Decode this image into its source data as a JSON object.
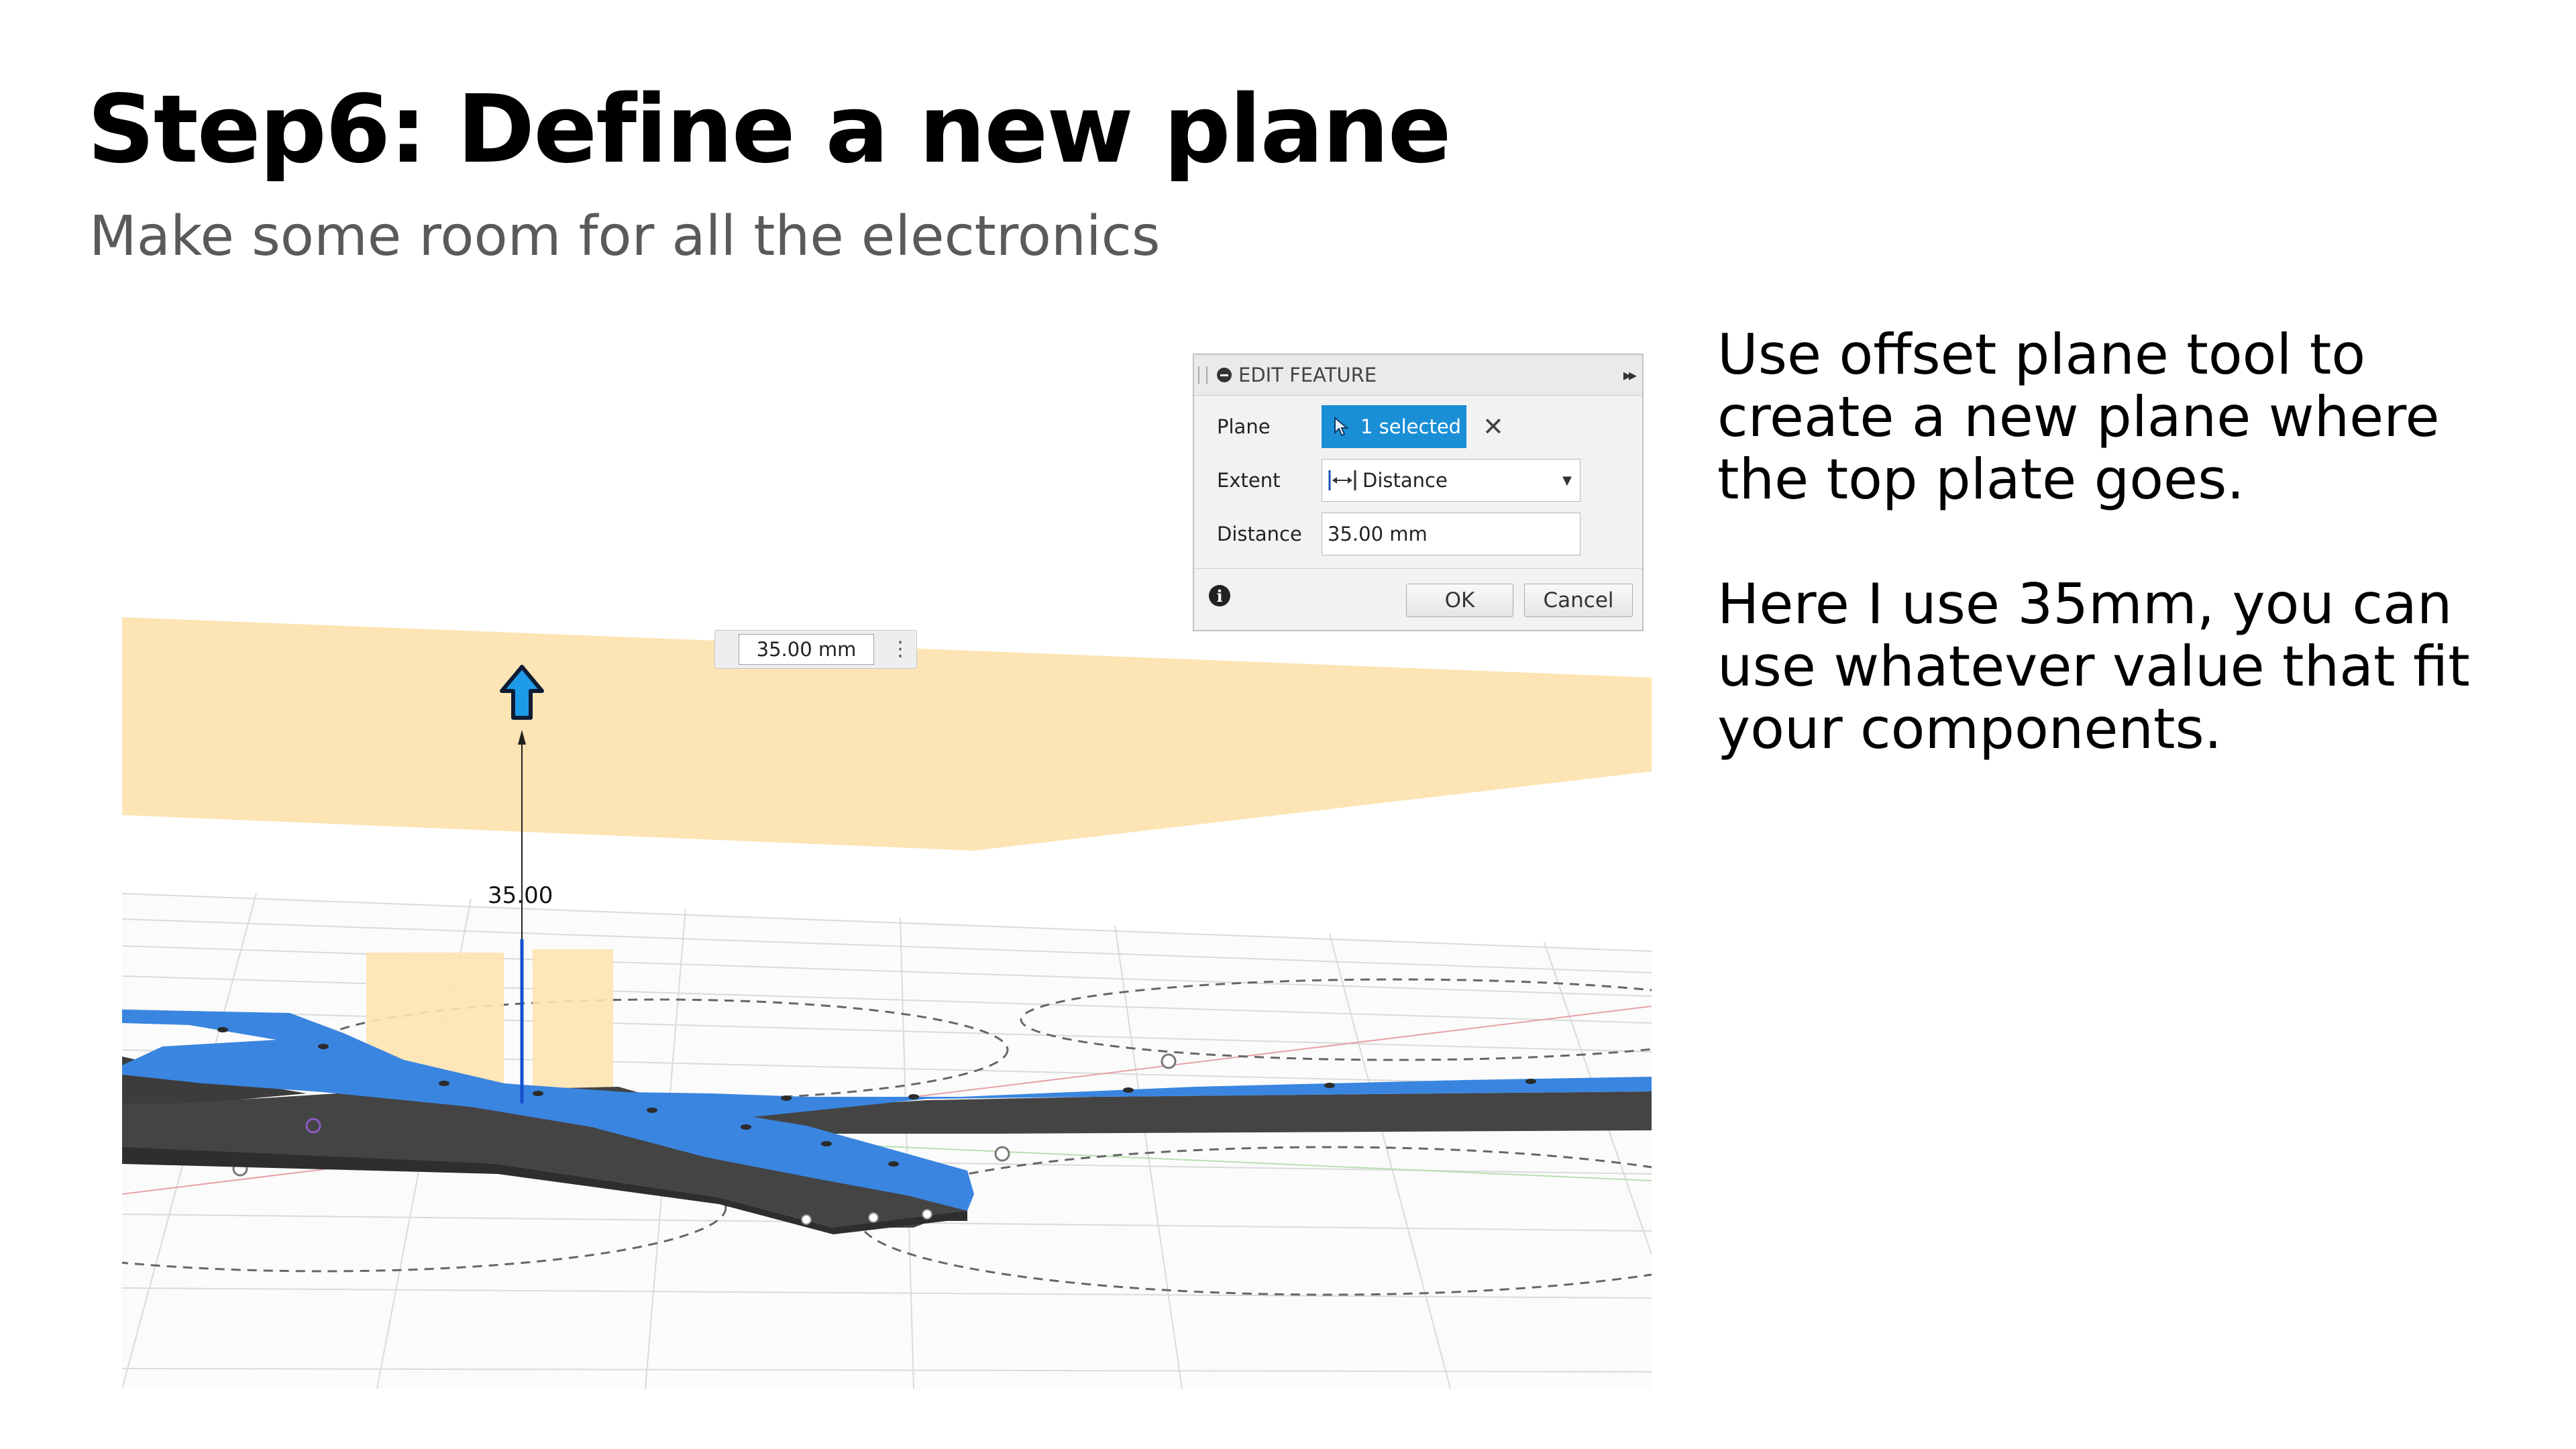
{
  "slide": {
    "title": "Step6: Define a new plane",
    "subtitle": "Make some room for all the electronics",
    "body_paragraphs": [
      "Use offset plane tool to create a new plane where the top plate goes.",
      "Here I use 35mm, you can use whatever value that fit your components."
    ]
  },
  "viewport": {
    "dimension_input_value": "35.00 mm",
    "dimension_label": "35.00",
    "colors": {
      "offset_plane": "#fde3b0",
      "plate_top": "#3a85e0",
      "plate_edge": "#3c3c3c",
      "grid": "#d9d9d9",
      "arrow": "#1e9be8"
    }
  },
  "dialog": {
    "title": "EDIT FEATURE",
    "plane_label": "Plane",
    "plane_value": "1 selected",
    "extent_label": "Extent",
    "extent_value": "Distance",
    "distance_label": "Distance",
    "distance_value": "35.00 mm",
    "ok_label": "OK",
    "cancel_label": "Cancel"
  }
}
